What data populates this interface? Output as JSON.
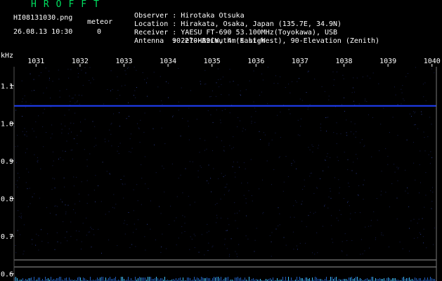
{
  "header": {
    "brand": "HROFFT",
    "filename": "HI08131030.png",
    "datetime": "26.08.13 10:30",
    "meteor_label": "meteor",
    "meteor_count": "0",
    "info": [
      {
        "label": "Observer",
        "value": "Hirotaka Otsuka"
      },
      {
        "label": "Location",
        "value": "Hirakata, Osaka, Japan (135.7E, 34.9N)"
      },
      {
        "label": "Receiver",
        "value": "YAESU FT-690 53.100MHz(Toyokawa), USB"
      },
      {
        "label": "Antenna ",
        "value": "2el-HB9CV, 4m's high"
      }
    ],
    "antenna_extra": "90-270-Azimuth (East-West), 90-Elevation (Zenith)"
  },
  "chart_data": {
    "type": "heatmap",
    "y_unit": "kHz",
    "x_ticks": [
      "1031",
      "1032",
      "1033",
      "1034",
      "1035",
      "1036",
      "1037",
      "1038",
      "1039",
      "1040"
    ],
    "y_ticks": [
      "1.1",
      "1.0",
      "0.9",
      "0.8",
      "0.7",
      "0.6"
    ],
    "ylim": [
      0.59,
      1.15
    ],
    "xlim": [
      1030.5,
      1040.1
    ],
    "carrier_khz": 1.046,
    "colors": {
      "background": "#000000",
      "axis": "#ffffff",
      "carrier": "#2040ff",
      "header_brand": "#00e060"
    }
  }
}
